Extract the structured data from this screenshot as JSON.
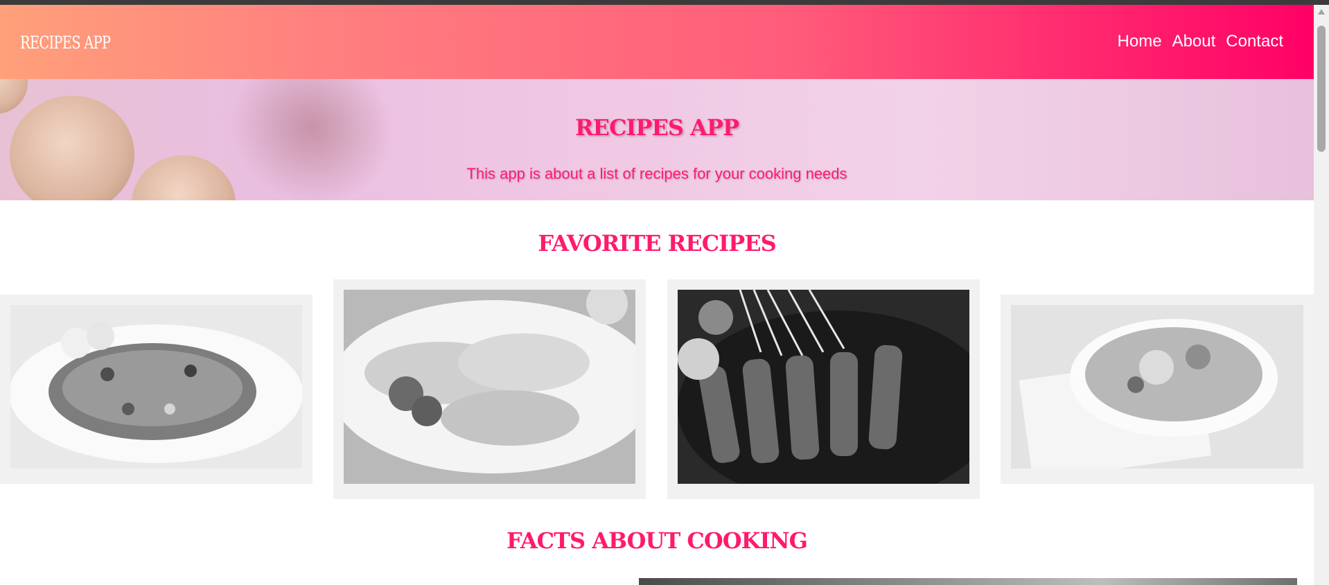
{
  "navbar": {
    "brand": "RECIPES APP",
    "links": [
      "Home",
      "About",
      "Contact"
    ]
  },
  "hero": {
    "title": "RECIPES APP",
    "subtitle": "This app is about a list of recipes for your cooking needs"
  },
  "favorites": {
    "title": "FAVORITE RECIPES",
    "images": [
      {
        "icon": "fried-rice-photo"
      },
      {
        "icon": "omelette-photo"
      },
      {
        "icon": "satay-skewers-photo"
      },
      {
        "icon": "soup-bowl-photo"
      }
    ]
  },
  "facts": {
    "title": "FACTS ABOUT COOKING"
  },
  "colors": {
    "accent": "#ff1a6e",
    "nav_gradient_start": "#ffa07a",
    "nav_gradient_end": "#ff0066",
    "card_bg": "#f1f1f1"
  }
}
